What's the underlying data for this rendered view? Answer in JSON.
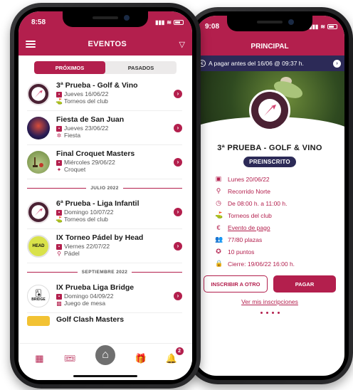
{
  "left": {
    "status_time": "8:58",
    "title": "EVENTOS",
    "tabs": {
      "upcoming": "PRÓXIMOS",
      "past": "PASADOS"
    },
    "events_a": [
      {
        "name": "3ª Prueba - Golf & Vino",
        "date": "Jueves 16/06/22",
        "category": "Torneos del club"
      },
      {
        "name": "Fiesta de San Juan",
        "date": "Jueves 23/06/22",
        "category": "Fiesta"
      },
      {
        "name": "Final Croquet Masters",
        "date": "Miércoles 29/06/22",
        "category": "Croquet"
      }
    ],
    "sep_july": "JULIO 2022",
    "events_b": [
      {
        "name": "6ª Prueba - Liga Infantil",
        "date": "Domingo 10/07/22",
        "category": "Torneos del club"
      },
      {
        "name": "IX Torneo Pádel by Head",
        "date": "Viernes 22/07/22",
        "category": "Pádel",
        "thumb_text": "HEAD"
      }
    ],
    "sep_sept": "SEPTIEMBRE 2022",
    "events_c": [
      {
        "name": "IX Prueba Liga Bridge",
        "date": "Domingo 04/09/22",
        "category": "Juego de mesa",
        "thumb_text": "BRIDGE"
      },
      {
        "name": "Golf Clash Masters"
      }
    ],
    "notification_count": "2"
  },
  "right": {
    "status_time": "9:08",
    "title": "PRINCIPAL",
    "pay_banner": "A pagar antes del 16/06 @ 09:37 h.",
    "event_title": "3ª PRUEBA - GOLF & VINO",
    "status_pill": "PREINSCRITO",
    "details": {
      "date": "Lunes 20/06/22",
      "route": "Recorrido Norte",
      "time": "De 08:00 h. a 11:00 h.",
      "category": "Torneos del club",
      "payment": "Evento de pago",
      "places": "77/80 plazas",
      "points": "10 puntos",
      "closing": "Cierre: 19/06/22 16:00 h."
    },
    "buttons": {
      "register_other": "INSCRIBIR A OTRO",
      "pay": "PAGAR"
    },
    "my_registrations": "Ver mis inscripciones"
  },
  "colors": {
    "brand": "#b31f4d",
    "navy": "#2c2a57"
  }
}
